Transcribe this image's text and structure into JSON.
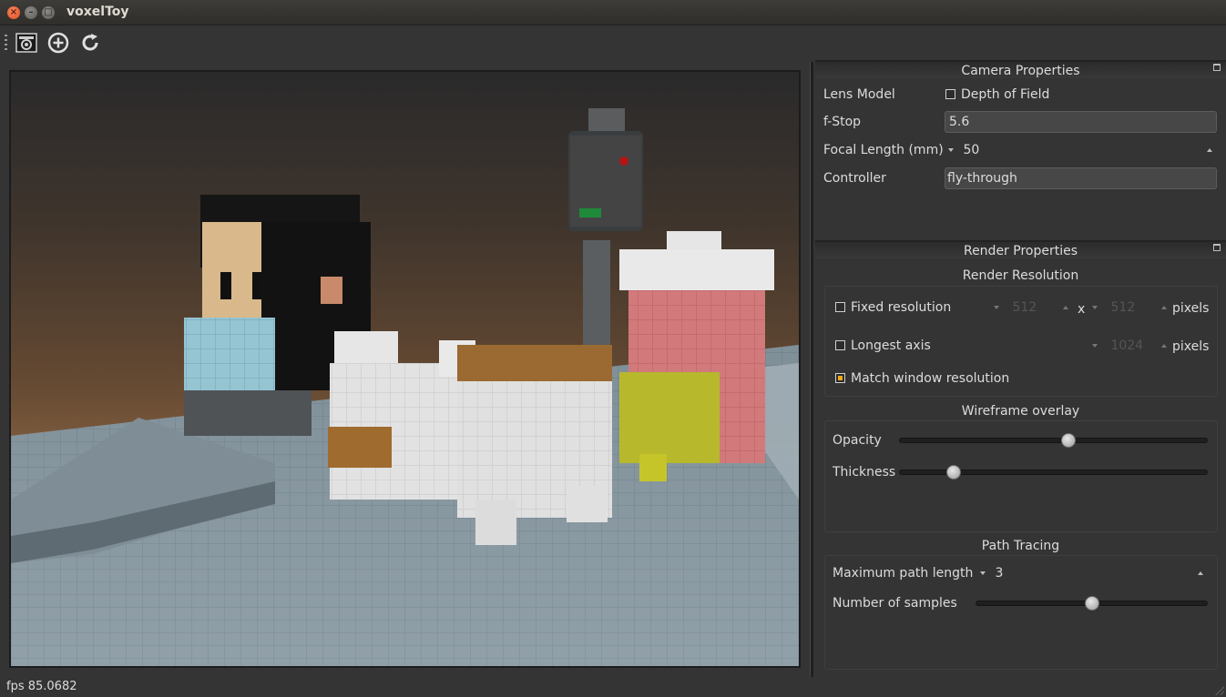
{
  "window": {
    "title": "voxelToy"
  },
  "toolbar": {
    "buttons": [
      {
        "icon": "camera-screenshot-icon"
      },
      {
        "icon": "add-circle-icon"
      },
      {
        "icon": "refresh-icon"
      }
    ]
  },
  "camera_panel": {
    "title": "Camera Properties",
    "lens_model_label": "Lens Model",
    "depth_of_field_label": "Depth of Field",
    "depth_of_field_checked": false,
    "fstop_label": "f-Stop",
    "fstop_value": "5.6",
    "focal_length_label": "Focal Length (mm)",
    "focal_length_value": "50",
    "controller_label": "Controller",
    "controller_value": "fly-through"
  },
  "render_panel": {
    "title": "Render Properties",
    "resolution_group": {
      "title": "Render Resolution",
      "fixed_label": "Fixed resolution",
      "fixed_checked": false,
      "fixed_width": "512",
      "times": "x",
      "fixed_height": "512",
      "pixels_label": "pixels",
      "longest_label": "Longest axis",
      "longest_checked": false,
      "longest_value": "1024",
      "match_label": "Match window resolution",
      "match_checked": true
    },
    "wireframe_group": {
      "title": "Wireframe overlay",
      "opacity_label": "Opacity",
      "opacity_value": 0.55,
      "thickness_label": "Thickness",
      "thickness_value": 0.16
    },
    "path_group": {
      "title": "Path Tracing",
      "max_path_label": "Maximum path length",
      "max_path_value": "3",
      "samples_label": "Number of samples",
      "samples_value": 0.5
    }
  },
  "status": {
    "fps_text": "fps 85.0682"
  },
  "colors": {
    "accent": "#f0a81a",
    "close_button": "#e95420"
  }
}
